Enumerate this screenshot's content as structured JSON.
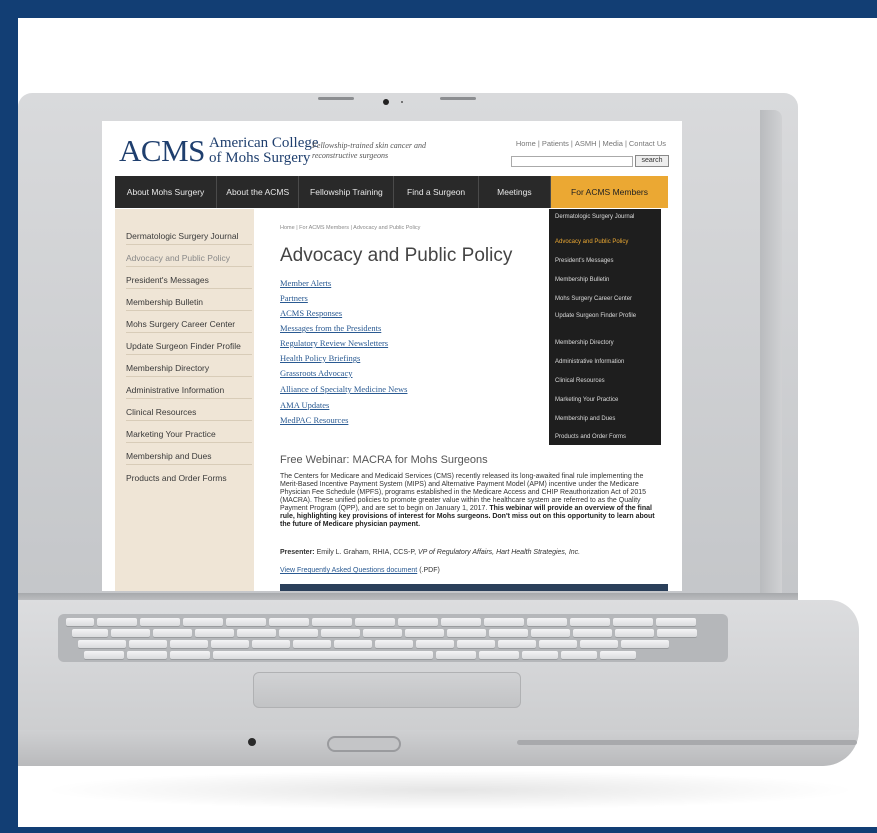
{
  "site": {
    "logo": "ACMS",
    "org_line1": "American College",
    "org_line2": "of Mohs Surgery",
    "tagline": "Fellowship-trained skin cancer and reconstructive surgeons",
    "top_links": [
      "Home",
      "Patients",
      "ASMH",
      "Media",
      "Contact Us"
    ],
    "search_button": "search"
  },
  "nav": [
    "About Mohs Surgery",
    "About the ACMS",
    "Fellowship Training",
    "Find a Surgeon",
    "Meetings",
    "For ACMS Members"
  ],
  "sidebar": [
    "Dermatologic Surgery Journal",
    "Advocacy and Public Policy",
    "President's Messages",
    "Membership Bulletin",
    "Mohs Surgery Career Center",
    "Update Surgeon Finder Profile",
    "Membership Directory",
    "Administrative Information",
    "Clinical Resources",
    "Marketing Your Practice",
    "Membership and Dues",
    "Products and Order Forms"
  ],
  "dropdown": [
    "Dermatologic Surgery Journal",
    "Advocacy and Public Policy",
    "President's Messages",
    "Membership Bulletin",
    "Mohs Surgery Career Center",
    "Update Surgeon Finder Profile",
    "Membership Directory",
    "Administrative Information",
    "Clinical Resources",
    "Marketing Your Practice",
    "Membership and Dues",
    "Products and Order Forms"
  ],
  "breadcrumb": "Home | For ACMS Members | Advocacy and Public Policy",
  "page_title": "Advocacy and Public Policy",
  "links": [
    "Member Alerts",
    "Partners",
    "ACMS Responses",
    "Messages from the Presidents",
    "Regulatory Review Newsletters",
    "Health Policy Briefings",
    "Grassroots Advocacy",
    "Alliance of Specialty Medicine News",
    "AMA Updates",
    "MedPAC Resources"
  ],
  "webinar": {
    "title": "Free Webinar: MACRA for Mohs Surgeons",
    "body": "The Centers for Medicare and Medicaid Services (CMS) recently released its long-awaited final rule implementing the Merit-Based Incentive Payment System (MIPS) and Alternative Payment Model (APM) incentive under the Medicare Physician Fee Schedule (MPFS), programs established in the Medicare Access and CHIP Reauthorization Act of 2015 (MACRA). These unified policies to promote greater value within the healthcare system are referred to as the Quality Payment Program (QPP), and are set to begin on January 1, 2017.",
    "body_bold": "This webinar will provide an overview of the final rule, highlighting key provisions of interest for Mohs surgeons. Don't miss out on this opportunity to learn about the future of Medicare physician payment.",
    "presenter_label": "Presenter:",
    "presenter_name": "Emily L. Graham, RHIA, CCS-P,",
    "presenter_role": "VP of Regulatory Affairs, Hart Health Strategies, Inc.",
    "faq_link": "View Frequently Asked Questions document",
    "faq_suffix": "(.PDF)"
  }
}
